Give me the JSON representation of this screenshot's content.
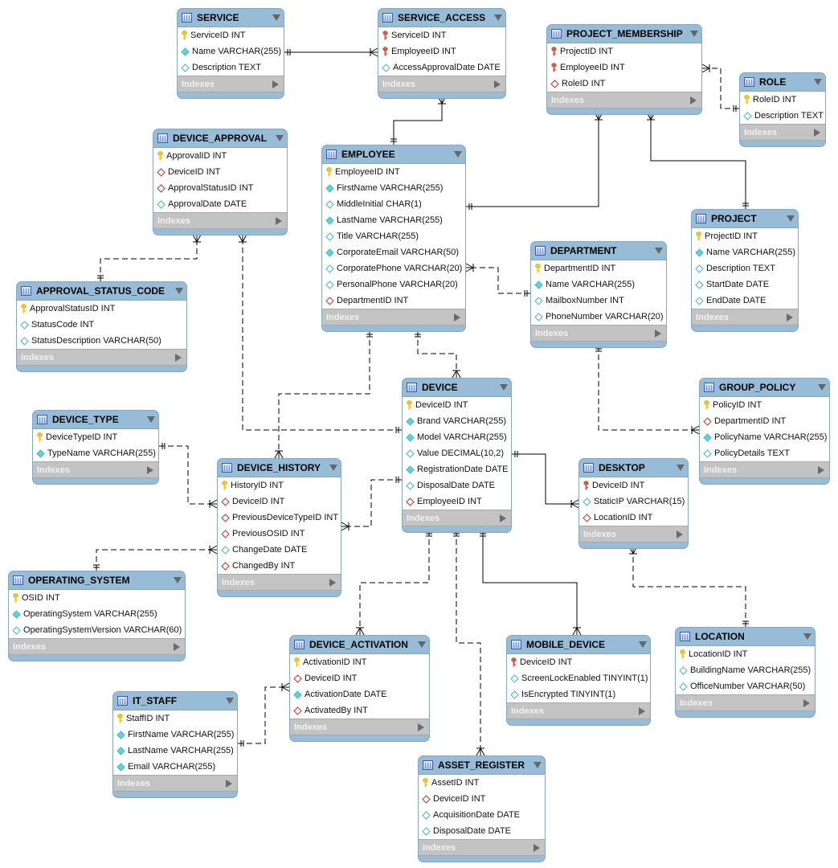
{
  "diagram": {
    "indexes_label": "Indexes",
    "colors": {
      "header": "#96bcd8",
      "indexes": "#c3c3c3",
      "pk": "#f5c518",
      "pk_fk": "#d9534f",
      "not_null": "#5fd3dc",
      "fk": "#c0392b"
    },
    "tables": [
      {
        "name": "SERVICE",
        "columns": [
          {
            "text": "ServiceID INT",
            "icon": "pk"
          },
          {
            "text": "Name VARCHAR(255)",
            "icon": "nn"
          },
          {
            "text": "Description TEXT",
            "icon": "null"
          }
        ]
      },
      {
        "name": "SERVICE_ACCESS",
        "columns": [
          {
            "text": "ServiceID INT",
            "icon": "pkfk"
          },
          {
            "text": "EmployeeID INT",
            "icon": "pkfk"
          },
          {
            "text": "AccessApprovalDate DATE",
            "icon": "null"
          }
        ]
      },
      {
        "name": "PROJECT_MEMBERSHIP",
        "columns": [
          {
            "text": "ProjectID INT",
            "icon": "pkfk"
          },
          {
            "text": "EmployeeID INT",
            "icon": "pkfk"
          },
          {
            "text": "RoleID INT",
            "icon": "fk"
          }
        ]
      },
      {
        "name": "ROLE",
        "columns": [
          {
            "text": "RoleID INT",
            "icon": "pk"
          },
          {
            "text": "Description TEXT",
            "icon": "null"
          }
        ]
      },
      {
        "name": "DEVICE_APPROVAL",
        "columns": [
          {
            "text": "ApprovalID INT",
            "icon": "pk"
          },
          {
            "text": "DeviceID INT",
            "icon": "fk"
          },
          {
            "text": "ApprovalStatusID INT",
            "icon": "fk"
          },
          {
            "text": "ApprovalDate DATE",
            "icon": "null"
          }
        ]
      },
      {
        "name": "EMPLOYEE",
        "columns": [
          {
            "text": "EmployeeID INT",
            "icon": "pk"
          },
          {
            "text": "FirstName VARCHAR(255)",
            "icon": "nn"
          },
          {
            "text": "MiddleInitial CHAR(1)",
            "icon": "null"
          },
          {
            "text": "LastName VARCHAR(255)",
            "icon": "nn"
          },
          {
            "text": "Title VARCHAR(255)",
            "icon": "null"
          },
          {
            "text": "CorporateEmail VARCHAR(50)",
            "icon": "nn"
          },
          {
            "text": "CorporatePhone VARCHAR(20)",
            "icon": "null"
          },
          {
            "text": "PersonalPhone VARCHAR(20)",
            "icon": "null"
          },
          {
            "text": "DepartmentID INT",
            "icon": "fk"
          }
        ]
      },
      {
        "name": "PROJECT",
        "columns": [
          {
            "text": "ProjectID INT",
            "icon": "pk"
          },
          {
            "text": "Name VARCHAR(255)",
            "icon": "nn"
          },
          {
            "text": "Description TEXT",
            "icon": "null"
          },
          {
            "text": "StartDate DATE",
            "icon": "null"
          },
          {
            "text": "EndDate DATE",
            "icon": "null"
          }
        ]
      },
      {
        "name": "DEPARTMENT",
        "columns": [
          {
            "text": "DepartmentID INT",
            "icon": "pk"
          },
          {
            "text": "Name VARCHAR(255)",
            "icon": "nn"
          },
          {
            "text": "MailboxNumber INT",
            "icon": "null"
          },
          {
            "text": "PhoneNumber VARCHAR(20)",
            "icon": "null"
          }
        ]
      },
      {
        "name": "APPROVAL_STATUS_CODE",
        "columns": [
          {
            "text": "ApprovalStatusID INT",
            "icon": "pk"
          },
          {
            "text": "StatusCode INT",
            "icon": "null"
          },
          {
            "text": "StatusDescription VARCHAR(50)",
            "icon": "null"
          }
        ]
      },
      {
        "name": "DEVICE",
        "columns": [
          {
            "text": "DeviceID INT",
            "icon": "pk"
          },
          {
            "text": "Brand VARCHAR(255)",
            "icon": "nn"
          },
          {
            "text": "Model VARCHAR(255)",
            "icon": "nn"
          },
          {
            "text": "Value DECIMAL(10,2)",
            "icon": "null"
          },
          {
            "text": "RegistrationDate DATE",
            "icon": "nn"
          },
          {
            "text": "DisposalDate DATE",
            "icon": "null"
          },
          {
            "text": "EmployeeID INT",
            "icon": "fk"
          }
        ]
      },
      {
        "name": "GROUP_POLICY",
        "columns": [
          {
            "text": "PolicyID INT",
            "icon": "pk"
          },
          {
            "text": "DepartmentID INT",
            "icon": "fk"
          },
          {
            "text": "PolicyName VARCHAR(255)",
            "icon": "nn"
          },
          {
            "text": "PolicyDetails TEXT",
            "icon": "null"
          }
        ]
      },
      {
        "name": "DEVICE_TYPE",
        "columns": [
          {
            "text": "DeviceTypeID INT",
            "icon": "pk"
          },
          {
            "text": "TypeName VARCHAR(255)",
            "icon": "nn"
          }
        ]
      },
      {
        "name": "DEVICE_HISTORY",
        "columns": [
          {
            "text": "HistoryID INT",
            "icon": "pk"
          },
          {
            "text": "DeviceID INT",
            "icon": "fk"
          },
          {
            "text": "PreviousDeviceTypeID INT",
            "icon": "fk"
          },
          {
            "text": "PreviousOSID INT",
            "icon": "fk"
          },
          {
            "text": "ChangeDate DATE",
            "icon": "null"
          },
          {
            "text": "ChangedBy INT",
            "icon": "fk"
          }
        ]
      },
      {
        "name": "DESKTOP",
        "columns": [
          {
            "text": "DeviceID INT",
            "icon": "pkfk"
          },
          {
            "text": "StaticIP VARCHAR(15)",
            "icon": "null"
          },
          {
            "text": "LocationID INT",
            "icon": "fk"
          }
        ]
      },
      {
        "name": "OPERATING_SYSTEM",
        "columns": [
          {
            "text": "OSID INT",
            "icon": "pk"
          },
          {
            "text": "OperatingSystem VARCHAR(255)",
            "icon": "nn"
          },
          {
            "text": "OperatingSystemVersion VARCHAR(60)",
            "icon": "null"
          }
        ]
      },
      {
        "name": "DEVICE_ACTIVATION",
        "columns": [
          {
            "text": "ActivationID INT",
            "icon": "pk"
          },
          {
            "text": "DeviceID INT",
            "icon": "fk"
          },
          {
            "text": "ActivationDate DATE",
            "icon": "nn"
          },
          {
            "text": "ActivatedBy INT",
            "icon": "fk"
          }
        ]
      },
      {
        "name": "MOBILE_DEVICE",
        "columns": [
          {
            "text": "DeviceID INT",
            "icon": "pkfk"
          },
          {
            "text": "ScreenLockEnabled TINYINT(1)",
            "icon": "null"
          },
          {
            "text": "IsEncrypted TINYINT(1)",
            "icon": "null"
          }
        ]
      },
      {
        "name": "LOCATION",
        "columns": [
          {
            "text": "LocationID INT",
            "icon": "pk"
          },
          {
            "text": "BuildingName VARCHAR(255)",
            "icon": "null"
          },
          {
            "text": "OfficeNumber VARCHAR(50)",
            "icon": "null"
          }
        ]
      },
      {
        "name": "IT_STAFF",
        "columns": [
          {
            "text": "StaffID INT",
            "icon": "pk"
          },
          {
            "text": "FirstName VARCHAR(255)",
            "icon": "nn"
          },
          {
            "text": "LastName VARCHAR(255)",
            "icon": "nn"
          },
          {
            "text": "Email VARCHAR(255)",
            "icon": "nn"
          }
        ]
      },
      {
        "name": "ASSET_REGISTER",
        "columns": [
          {
            "text": "AssetID INT",
            "icon": "pk"
          },
          {
            "text": "DeviceID INT",
            "icon": "fk"
          },
          {
            "text": "AcquisitionDate DATE",
            "icon": "null"
          },
          {
            "text": "DisposalDate DATE",
            "icon": "null"
          }
        ]
      }
    ],
    "relationships": [
      {
        "one": "SERVICE",
        "many": "SERVICE_ACCESS",
        "identifying": true
      },
      {
        "one": "EMPLOYEE",
        "many": "SERVICE_ACCESS",
        "identifying": true
      },
      {
        "one": "EMPLOYEE",
        "many": "PROJECT_MEMBERSHIP",
        "identifying": true
      },
      {
        "one": "PROJECT",
        "many": "PROJECT_MEMBERSHIP",
        "identifying": true
      },
      {
        "one": "ROLE",
        "many": "PROJECT_MEMBERSHIP",
        "identifying": false
      },
      {
        "one": "DEPARTMENT",
        "many": "EMPLOYEE",
        "identifying": false
      },
      {
        "one": "APPROVAL_STATUS_CODE",
        "many": "DEVICE_APPROVAL",
        "identifying": false
      },
      {
        "one": "DEVICE",
        "many": "DEVICE_APPROVAL",
        "identifying": false
      },
      {
        "one": "EMPLOYEE",
        "many": "DEVICE_HISTORY",
        "identifying": false
      },
      {
        "one": "EMPLOYEE",
        "many": "DEVICE",
        "identifying": false
      },
      {
        "one": "DEVICE_TYPE",
        "many": "DEVICE_HISTORY",
        "identifying": false
      },
      {
        "one": "OPERATING_SYSTEM",
        "many": "DEVICE_HISTORY",
        "identifying": false
      },
      {
        "one": "DEVICE",
        "many": "DEVICE_HISTORY",
        "identifying": false
      },
      {
        "one": "DEVICE",
        "many": "DESKTOP",
        "identifying": true
      },
      {
        "one": "DEPARTMENT",
        "many": "GROUP_POLICY",
        "identifying": false
      },
      {
        "one": "LOCATION",
        "many": "DESKTOP",
        "identifying": false
      },
      {
        "one": "DEVICE",
        "many": "DEVICE_ACTIVATION",
        "identifying": false
      },
      {
        "one": "DEVICE",
        "many": "ASSET_REGISTER",
        "identifying": false
      },
      {
        "one": "DEVICE",
        "many": "MOBILE_DEVICE",
        "identifying": true
      },
      {
        "one": "IT_STAFF",
        "many": "DEVICE_ACTIVATION",
        "identifying": false
      }
    ]
  }
}
